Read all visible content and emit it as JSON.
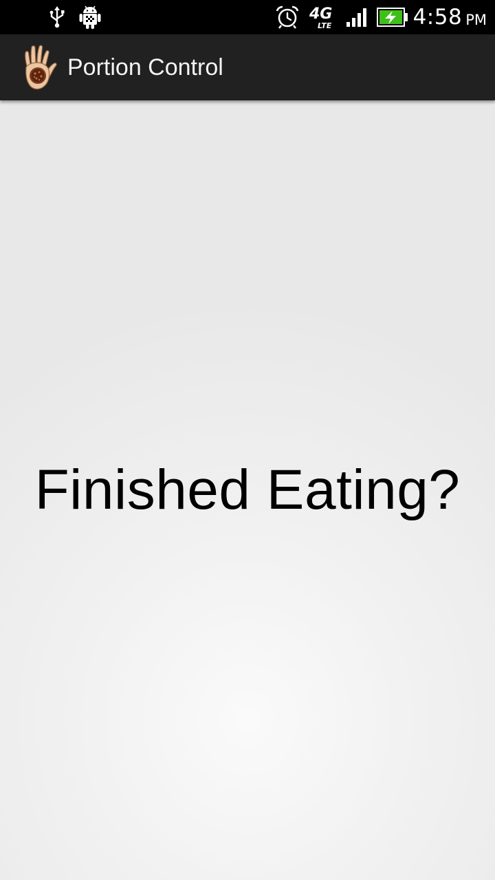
{
  "status_bar": {
    "time": "4:58",
    "ampm": "PM",
    "network": "4G",
    "network_sub": "LTE",
    "icons": [
      "usb-icon",
      "android-debug-icon",
      "alarm-icon",
      "lte-4g-icon",
      "signal-icon",
      "battery-charging-icon"
    ],
    "battery_color": "#3fbf1a"
  },
  "action_bar": {
    "title": "Portion Control",
    "icon": "hand-icon"
  },
  "main": {
    "prompt": "Finished Eating?"
  }
}
